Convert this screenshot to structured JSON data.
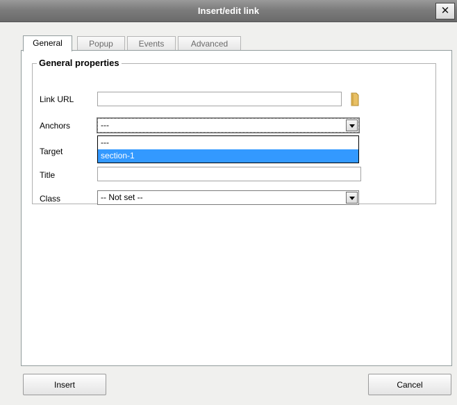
{
  "window": {
    "title": "Insert/edit link",
    "close_label": "✕"
  },
  "tabs": [
    {
      "label": "General",
      "active": true
    },
    {
      "label": "Popup",
      "active": false
    },
    {
      "label": "Events",
      "active": false
    },
    {
      "label": "Advanced",
      "active": false
    }
  ],
  "general": {
    "legend": "General properties",
    "link_url": {
      "label": "Link URL",
      "value": ""
    },
    "anchors": {
      "label": "Anchors",
      "selected": "---",
      "options": [
        "---",
        "section-1"
      ],
      "highlighted": "section-1"
    },
    "target": {
      "label": "Target"
    },
    "title": {
      "label": "Title",
      "value": ""
    },
    "class": {
      "label": "Class",
      "selected": "-- Not set --"
    }
  },
  "buttons": {
    "insert": "Insert",
    "cancel": "Cancel"
  },
  "icons": {
    "browse": "folder-icon",
    "close": "close-icon",
    "dropdown": "chevron-down-icon"
  },
  "colors": {
    "title_bar": "#7c7c7c",
    "highlight": "#3399ff",
    "dialog_bg": "#f0f0ee"
  }
}
